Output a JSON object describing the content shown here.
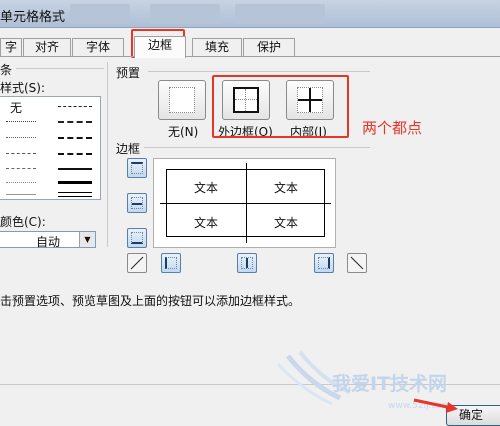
{
  "window": {
    "title": "单元格格式"
  },
  "tabs": [
    "字",
    "对齐",
    "字体",
    "边框",
    "填充",
    "保护"
  ],
  "active_tab": "边框",
  "line_section": {
    "group_label": "条",
    "style_label": "样式(S):",
    "none_label": "无",
    "color_label": "颜色(C):",
    "color_value": "自动"
  },
  "presets": {
    "group_label": "预置",
    "buttons": [
      {
        "label": "无(N)"
      },
      {
        "label": "外边框(O)"
      },
      {
        "label": "内部(I)"
      }
    ],
    "annotation": "两个都点"
  },
  "border_section": {
    "group_label": "边框",
    "cell_text": "文本"
  },
  "hint": "击预置选项、预览草图及上面的按钮可以添加边框样式。",
  "footer": {
    "ok_label": "确定"
  },
  "watermark": {
    "text": "我爱IT技术网",
    "url": "www.52ij.com"
  },
  "colors": {
    "highlight": "#e8352a",
    "title_bar": "#b8c8dc"
  }
}
